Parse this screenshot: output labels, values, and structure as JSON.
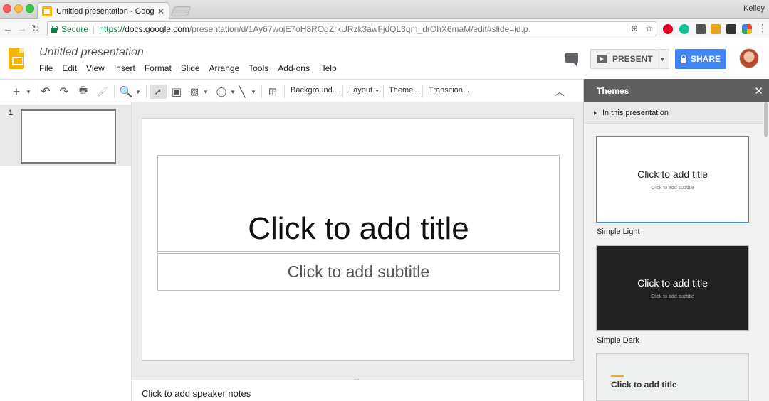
{
  "browser": {
    "tab_title": "Untitled presentation - Google",
    "tab_close": "✕",
    "user_name": "Kelley",
    "secure_label": "Secure",
    "url_scheme": "https://",
    "url_host": "docs.google.com",
    "url_path": "/presentation/d/1Ay67wojE7oH8ROgZrkURzk3awFjdQL3qm_drOhX6maM/edit#slide=id.p"
  },
  "app": {
    "doc_title": "Untitled presentation",
    "menus": [
      "File",
      "Edit",
      "View",
      "Insert",
      "Format",
      "Slide",
      "Arrange",
      "Tools",
      "Add-ons",
      "Help"
    ],
    "present_label": "PRESENT",
    "share_label": "SHARE"
  },
  "toolbar": {
    "background_label": "Background...",
    "layout_label": "Layout",
    "theme_label": "Theme...",
    "transition_label": "Transition..."
  },
  "filmstrip": {
    "slide_number": "1"
  },
  "slide": {
    "title_placeholder": "Click to add title",
    "subtitle_placeholder": "Click to add subtitle"
  },
  "notes": {
    "placeholder": "Click to add speaker notes"
  },
  "themes_panel": {
    "title": "Themes",
    "close": "✕",
    "section": "In this presentation",
    "cards": [
      {
        "name": "Simple Light",
        "title": "Click to add title",
        "subtitle": "Click to add subtitle"
      },
      {
        "name": "Simple Dark",
        "title": "Click to add title",
        "subtitle": "Click to add subtitle"
      },
      {
        "name": "",
        "title": "Click to add title"
      }
    ]
  },
  "colors": {
    "accent_blue": "#4285f4",
    "slides_yellow": "#f4b400",
    "secure_green": "#0b8043",
    "themes_header": "#5f5f5f"
  }
}
